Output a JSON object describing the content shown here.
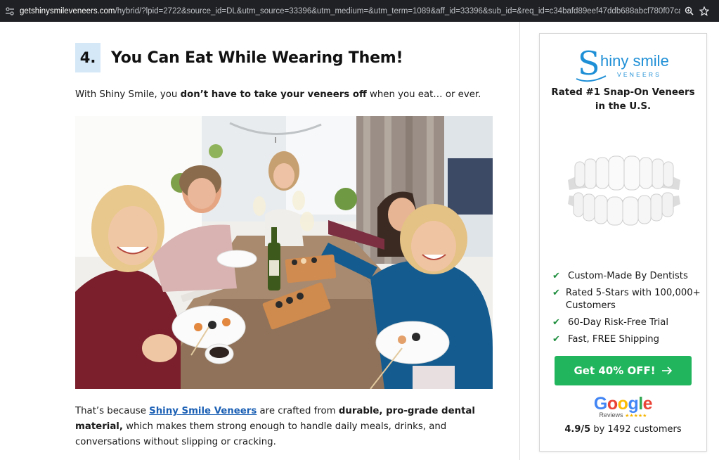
{
  "browser": {
    "url_host": "getshinysmileveneers.com",
    "url_path": "/hybrid/?lpid=2722&source_id=DL&utm_source=33396&utm_medium=&utm_term=1089&aff_id=33396&sub_id=&req_id=c34bafd89eef47ddb688abcf780f07ca&oid=1089&device_type=&c...",
    "zoom_icon": "zoom-icon",
    "bookmark_icon": "star-icon"
  },
  "article": {
    "step_number": "4.",
    "step_title": "You Can Eat While Wearing Them!",
    "intro_pre": "With Shiny Smile, you ",
    "intro_bold": "don’t have to take your veneers off",
    "intro_post": " when you eat… or ever.",
    "body_1": "That’s because ",
    "body_link": "Shiny Smile Veneers",
    "body_2": " are crafted from ",
    "body_bold": "durable, pro-grade dental material,",
    "body_3": " which makes them strong enough to handle daily meals, drinks, and conversations without slipping or cracking."
  },
  "sidebar": {
    "logo_word": "hiny smile",
    "logo_initial": "S",
    "logo_sub": "VENEERS",
    "headline_line1": "Rated #1 Snap-On Veneers",
    "headline_line2": "in the U.S.",
    "features": [
      "Custom-Made By Dentists",
      "Rated 5-Stars with 100,000+ Customers",
      "60-Day Risk-Free Trial",
      "Fast, FREE Shipping"
    ],
    "cta_label": "Get 40% OFF!",
    "google_word": "Google",
    "google_sub": "Reviews",
    "google_stars": "★★★★★",
    "rating_value": "4.9/5",
    "rating_text": " by 1492 customers"
  },
  "colors": {
    "accent_green": "#21b55d",
    "link_blue": "#1a5fb4",
    "step_badge": "#d5e8f7",
    "brand_blue": "#1f8fd6"
  }
}
